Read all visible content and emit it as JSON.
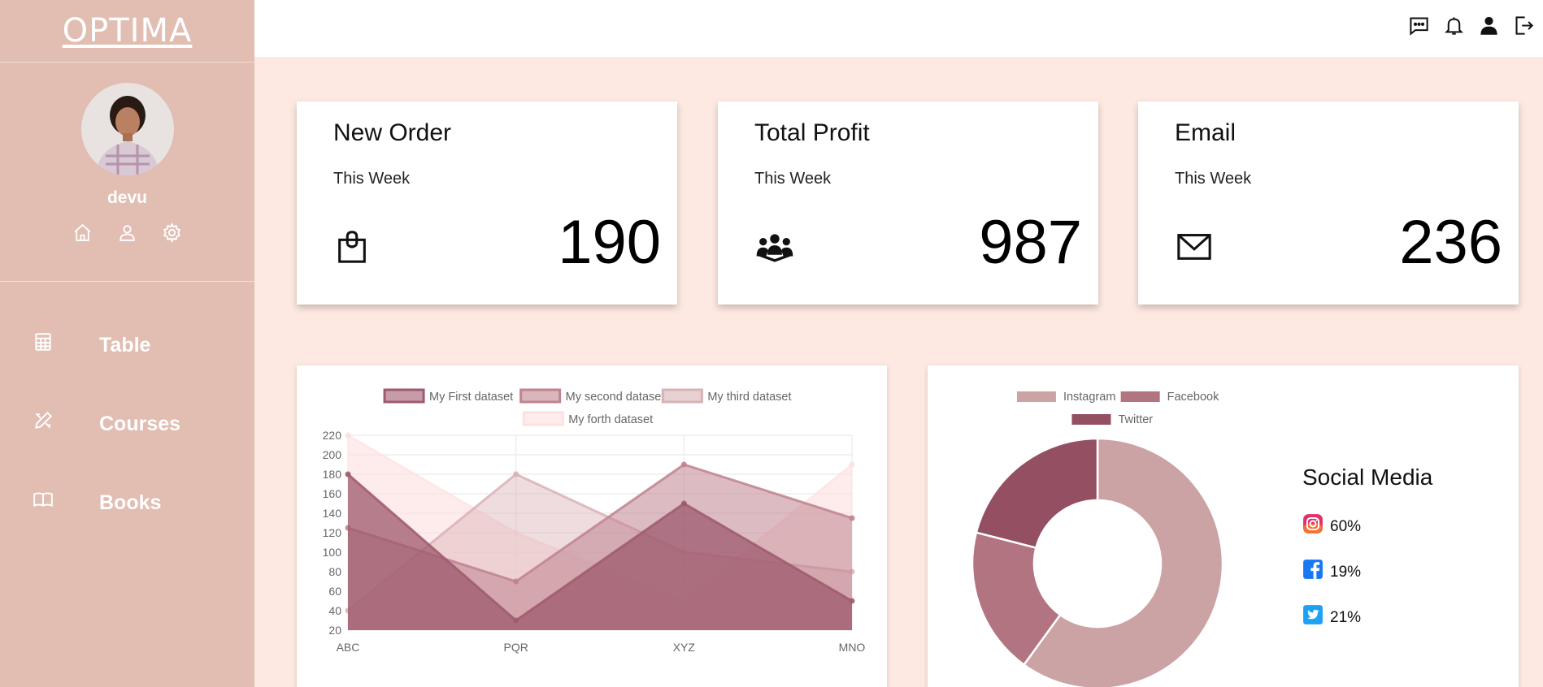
{
  "brand": {
    "name": "OPTIMA"
  },
  "profile": {
    "username": "devu"
  },
  "nav": {
    "items": [
      {
        "label": "Table",
        "icon": "table-icon"
      },
      {
        "label": "Courses",
        "icon": "pencil-ruler-icon"
      },
      {
        "label": "Books",
        "icon": "book-icon"
      }
    ]
  },
  "cards": [
    {
      "title": "New Order",
      "subtitle": "This Week",
      "value": "190",
      "icon": "shopping-bag-icon"
    },
    {
      "title": "Total Profit",
      "subtitle": "This Week",
      "value": "987",
      "icon": "people-icon"
    },
    {
      "title": "Email",
      "subtitle": "This Week",
      "value": "236",
      "icon": "mail-icon"
    }
  ],
  "social": {
    "title": "Social Media",
    "rows": [
      {
        "icon": "instagram-icon",
        "value": "60%"
      },
      {
        "icon": "facebook-icon",
        "value": "19%"
      },
      {
        "icon": "twitter-icon",
        "value": "21%"
      }
    ]
  },
  "colors": {
    "sidebar": "#e1bdb2",
    "background": "#fde9e1",
    "series1": "#9e5a6e",
    "series2": "#c0838f",
    "series3": "#d9b2b6",
    "series4": "#fde0e0"
  },
  "chart_data": [
    {
      "type": "area",
      "categories": [
        "ABC",
        "PQR",
        "XYZ",
        "MNO"
      ],
      "series": [
        {
          "name": "My First dataset",
          "values": [
            180,
            30,
            150,
            50
          ],
          "color": "#9e5a6e"
        },
        {
          "name": "My second dataset",
          "values": [
            125,
            70,
            190,
            135
          ],
          "color": "#c0838f"
        },
        {
          "name": "My third dataset",
          "values": [
            40,
            180,
            100,
            80
          ],
          "color": "#d9b2b6"
        },
        {
          "name": "My forth dataset",
          "values": [
            220,
            120,
            50,
            190
          ],
          "color": "#fde0e0"
        }
      ],
      "yticks": [
        20,
        40,
        60,
        80,
        100,
        120,
        140,
        160,
        180,
        200,
        220
      ],
      "ylim": [
        20,
        220
      ],
      "grid": true,
      "legend": "top"
    },
    {
      "type": "pie",
      "labels": [
        "Instagram",
        "Facebook",
        "Twitter"
      ],
      "values": [
        60,
        19,
        21
      ],
      "colors": [
        "#cba3a4",
        "#b27480",
        "#944f62"
      ],
      "doughnut": true,
      "legend": "top"
    }
  ]
}
